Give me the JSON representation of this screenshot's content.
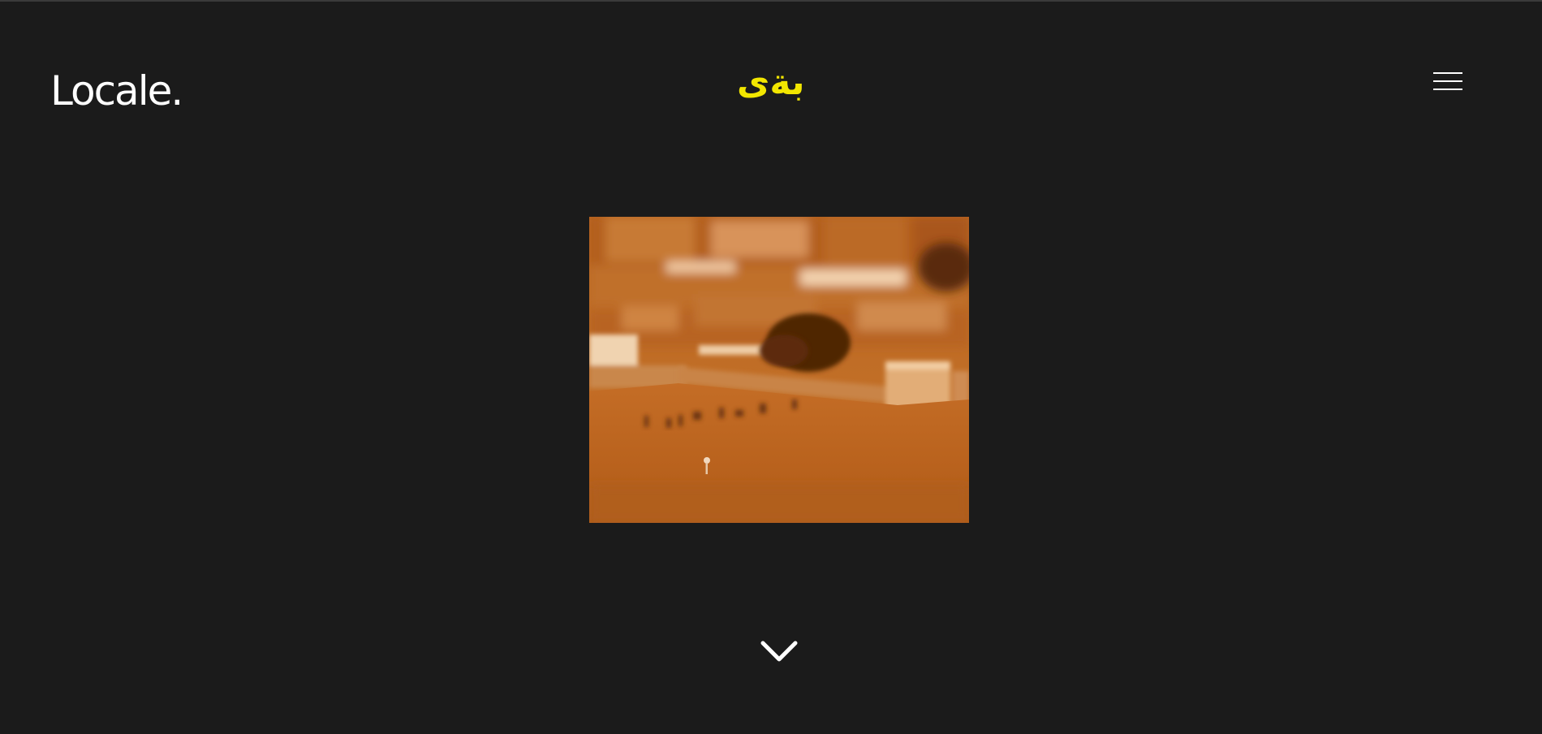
{
  "header": {
    "logo_text": "Locale.",
    "title_text": "بةى",
    "title_color": "#f2e600",
    "menu_icon": "hamburger-menu-icon"
  },
  "hero": {
    "image_subject": "village-desert-scene",
    "tint_color": "#c46a22"
  },
  "scroll_icon": "chevron-down-icon"
}
